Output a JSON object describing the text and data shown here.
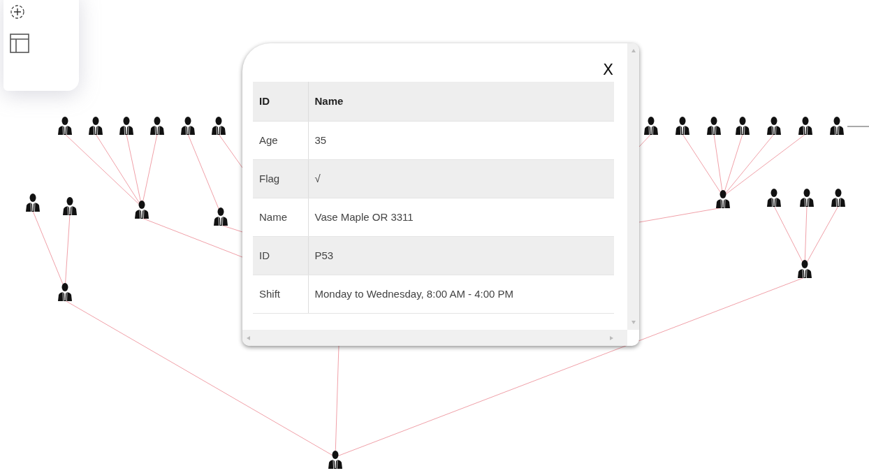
{
  "toolbar": {
    "buttons": [
      {
        "kind": "zoom-in"
      },
      {
        "kind": "layout"
      }
    ]
  },
  "diagram": {
    "nodes": [
      {
        "kind": "person",
        "children": [
          {
            "kind": "person",
            "children": [
              {
                "kind": "person"
              },
              {
                "kind": "person"
              }
            ]
          },
          {
            "kind": "person",
            "children": [
              {
                "kind": "person"
              },
              {
                "kind": "person"
              },
              {
                "kind": "person"
              }
            ]
          }
        ]
      },
      {
        "kind": "person",
        "children": [
          {
            "kind": "person"
          },
          {
            "kind": "person"
          },
          {
            "kind": "person"
          },
          {
            "kind": "person"
          }
        ]
      },
      {
        "kind": "person",
        "children": [
          {
            "kind": "person"
          }
        ]
      },
      {
        "kind": "person"
      },
      {
        "kind": "person",
        "children": [
          {
            "kind": "person"
          },
          {
            "kind": "person"
          },
          {
            "kind": "person"
          },
          {
            "kind": "person"
          },
          {
            "kind": "person"
          }
        ]
      },
      {
        "kind": "person"
      },
      {
        "kind": "person"
      }
    ]
  },
  "popup": {
    "close": "X",
    "table": {
      "columns": [
        "ID",
        "Name"
      ],
      "rows": [
        {
          "key": "Age",
          "value": "35"
        },
        {
          "key": "Flag",
          "value": "√"
        },
        {
          "key": "Name",
          "value": "Vase Maple OR 3311"
        },
        {
          "key": "ID",
          "value": "P53"
        },
        {
          "key": "Shift",
          "value": "Monday to Wednesday, 8:00 AM - 4:00 PM"
        }
      ]
    }
  }
}
